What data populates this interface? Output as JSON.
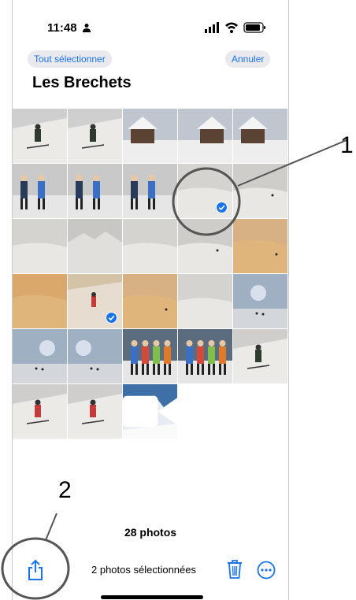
{
  "status_bar": {
    "time": "11:48"
  },
  "header": {
    "select_all_label": "Tout sélectionner",
    "cancel_label": "Annuler",
    "album_title": "Les Brechets"
  },
  "grid": {
    "selected_indices": [
      8,
      16
    ],
    "video_indices": [
      27
    ]
  },
  "footer": {
    "photo_count": "28 photos",
    "selected_text": "2 photos sélectionnées"
  },
  "annotations": {
    "callout_1": "1",
    "callout_2": "2"
  },
  "colors": {
    "accent": "#1a73e8",
    "pill_bg": "#e9e9ee",
    "snow": "#e7e5e1",
    "sand": "#d9a86a",
    "sky": "#a7b5c4"
  },
  "icons": [
    "person-icon",
    "signal-icon",
    "wifi-icon",
    "battery-icon",
    "checkmark-icon",
    "share-icon",
    "trash-icon",
    "more-icon",
    "video-icon"
  ]
}
